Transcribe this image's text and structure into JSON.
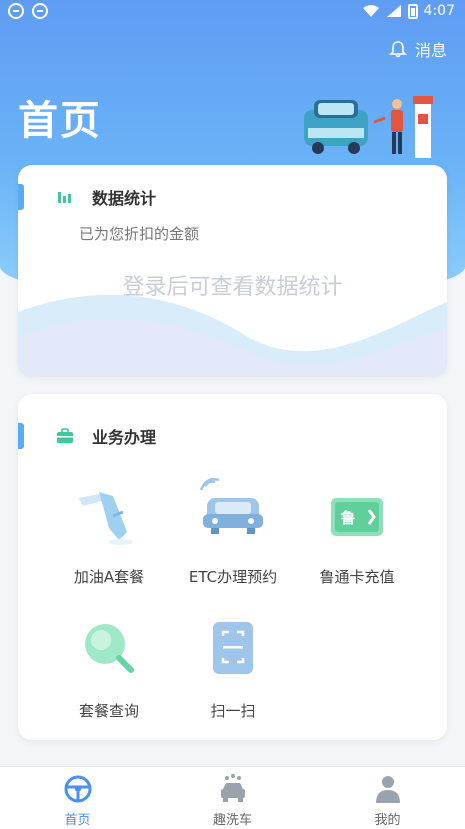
{
  "status": {
    "time": "4:07"
  },
  "header": {
    "title": "首页",
    "message_label": "消息"
  },
  "stats_card": {
    "title": "数据统计",
    "subtitle": "已为您折扣的金额",
    "login_hint": "登录后可查看数据统计"
  },
  "business_card": {
    "title": "业务办理",
    "items": [
      {
        "label": "加油A套餐",
        "icon": "fuel-nozzle-icon"
      },
      {
        "label": "ETC办理预约",
        "icon": "etc-car-icon"
      },
      {
        "label": "鲁通卡充值",
        "icon": "card-recharge-icon",
        "badge": "鲁"
      },
      {
        "label": "套餐查询",
        "icon": "magnifier-icon"
      },
      {
        "label": "扫一扫",
        "icon": "scan-icon"
      }
    ]
  },
  "tabbar": {
    "items": [
      {
        "label": "首页",
        "icon": "steering-wheel-icon",
        "active": true
      },
      {
        "label": "趣洗车",
        "icon": "car-wash-icon",
        "active": false
      },
      {
        "label": "我的",
        "icon": "person-icon",
        "active": false
      }
    ]
  },
  "colors": {
    "accent": "#4a8ff2",
    "hero_top": "#5f9cf4",
    "hero_bottom": "#8fd1fb"
  }
}
